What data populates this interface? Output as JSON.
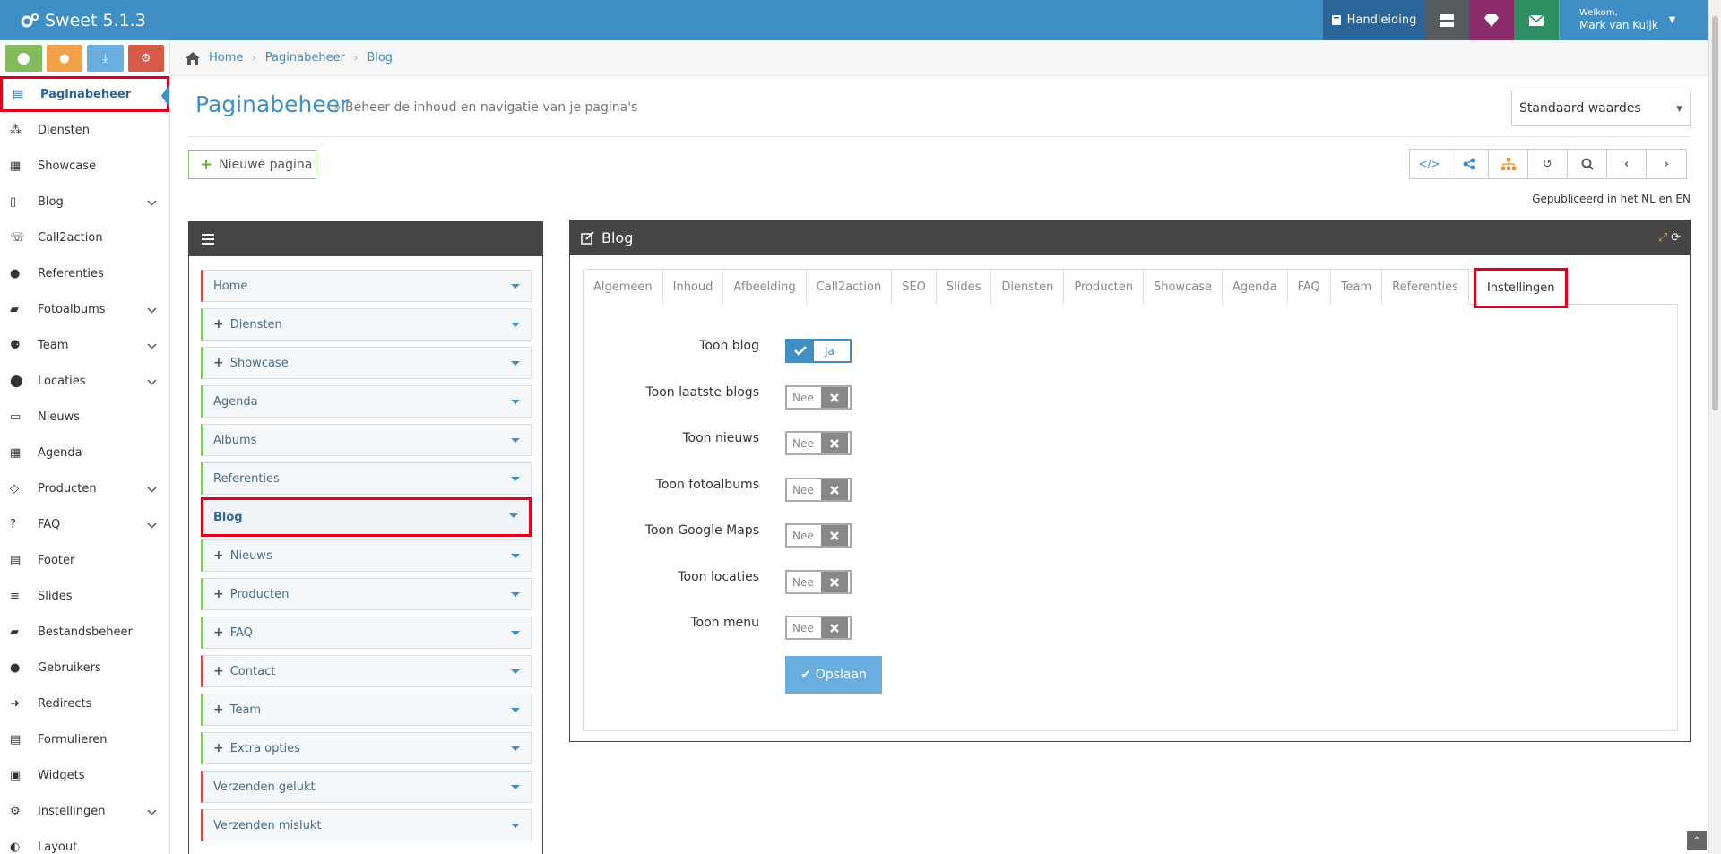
{
  "app": {
    "title": "Sweet 5.1.3"
  },
  "topbar": {
    "manual_label": "Handleiding",
    "welcome": "Welkom,",
    "user_name": "Mark van Kuijk"
  },
  "sidebar": {
    "items": [
      {
        "label": "Paginabeheer",
        "icon": "table-icon",
        "active": true
      },
      {
        "label": "Diensten",
        "icon": "cubes-icon"
      },
      {
        "label": "Showcase",
        "icon": "grid-icon"
      },
      {
        "label": "Blog",
        "icon": "document-icon",
        "expandable": true
      },
      {
        "label": "Call2action",
        "icon": "phone-icon"
      },
      {
        "label": "Referenties",
        "icon": "comments-icon"
      },
      {
        "label": "Fotoalbums",
        "icon": "folder-icon",
        "expandable": true
      },
      {
        "label": "Team",
        "icon": "users-icon",
        "expandable": true
      },
      {
        "label": "Locaties",
        "icon": "map-marker-icon",
        "expandable": true
      },
      {
        "label": "Nieuws",
        "icon": "newspaper-icon"
      },
      {
        "label": "Agenda",
        "icon": "calendar-icon"
      },
      {
        "label": "Producten",
        "icon": "tags-icon",
        "expandable": true
      },
      {
        "label": "FAQ",
        "icon": "question-icon",
        "expandable": true
      },
      {
        "label": "Footer",
        "icon": "footer-icon"
      },
      {
        "label": "Slides",
        "icon": "sliders-icon"
      },
      {
        "label": "Bestandsbeheer",
        "icon": "folder-open-icon"
      },
      {
        "label": "Gebruikers",
        "icon": "user-icon"
      },
      {
        "label": "Redirects",
        "icon": "redirect-icon"
      },
      {
        "label": "Formulieren",
        "icon": "form-icon"
      },
      {
        "label": "Widgets",
        "icon": "widgets-icon"
      },
      {
        "label": "Instellingen",
        "icon": "gear-icon",
        "expandable": true
      },
      {
        "label": "Layout",
        "icon": "palette-icon"
      }
    ]
  },
  "breadcrumb": {
    "items": [
      "Home",
      "Paginabeheer",
      "Blog"
    ]
  },
  "header": {
    "title": "Paginabeheer",
    "subtitle": "» Beheer de inhoud en navigatie van je pagina's",
    "select_value": "Standaard waardes",
    "new_page_label": "Nieuwe pagina",
    "published_text": "Gepubliceerd in het NL en EN"
  },
  "tree": {
    "items": [
      {
        "label": "Home",
        "plus": false,
        "color": "red"
      },
      {
        "label": "Diensten",
        "plus": true,
        "color": "green"
      },
      {
        "label": "Showcase",
        "plus": true,
        "color": "green"
      },
      {
        "label": "Agenda",
        "plus": false,
        "color": "green"
      },
      {
        "label": "Albums",
        "plus": false,
        "color": "green"
      },
      {
        "label": "Referenties",
        "plus": false,
        "color": "green"
      },
      {
        "label": "Blog",
        "plus": false,
        "color": "green",
        "active": true
      },
      {
        "label": "Nieuws",
        "plus": true,
        "color": "green"
      },
      {
        "label": "Producten",
        "plus": true,
        "color": "green"
      },
      {
        "label": "FAQ",
        "plus": true,
        "color": "green"
      },
      {
        "label": "Contact",
        "plus": true,
        "color": "red"
      },
      {
        "label": "Team",
        "plus": true,
        "color": "green"
      },
      {
        "label": "Extra opties",
        "plus": true,
        "color": "green"
      },
      {
        "label": "Verzenden gelukt",
        "plus": false,
        "color": "red"
      },
      {
        "label": "Verzenden mislukt",
        "plus": false,
        "color": "red"
      }
    ]
  },
  "panel": {
    "title": "Blog",
    "tabs": [
      "Algemeen",
      "Inhoud",
      "Afbeelding",
      "Call2action",
      "SEO",
      "Slides",
      "Diensten",
      "Producten",
      "Showcase",
      "Agenda",
      "FAQ",
      "Team",
      "Referenties",
      "Instellingen"
    ],
    "active_tab": "Instellingen",
    "settings": [
      {
        "label": "Toon blog",
        "value": "Ja",
        "on": true
      },
      {
        "label": "Toon laatste blogs",
        "value": "Nee",
        "on": false
      },
      {
        "label": "Toon nieuws",
        "value": "Nee",
        "on": false
      },
      {
        "label": "Toon fotoalbums",
        "value": "Nee",
        "on": false
      },
      {
        "label": "Toon Google Maps",
        "value": "Nee",
        "on": false
      },
      {
        "label": "Toon locaties",
        "value": "Nee",
        "on": false
      },
      {
        "label": "Toon menu",
        "value": "Nee",
        "on": false
      }
    ],
    "save_label": "Opslaan"
  }
}
